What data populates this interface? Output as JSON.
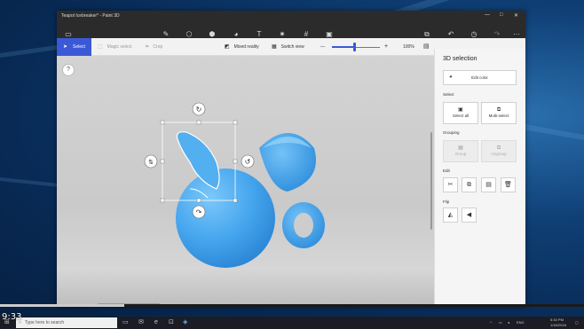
{
  "window": {
    "title": "Teapot Icebreaker* - Paint 3D",
    "min_icon": "—",
    "max_icon": "□",
    "close_icon": "✕"
  },
  "menubar": {
    "icons": {
      "menu": "▭",
      "brushes": "✎",
      "shapes2d": "⬡",
      "shapes3d": "⬢",
      "stickers": "◕",
      "text": "T",
      "effects": "✷",
      "canvas": "#",
      "library": "▣",
      "paste": "⧉",
      "undo": "↶",
      "history": "◷",
      "redo": "↷",
      "more": "···"
    }
  },
  "toolbar": {
    "select_label": "Select",
    "magic_select_label": "Magic select",
    "crop_label": "Crop",
    "mixed_reality_label": "Mixed reality",
    "switch_view_label": "Switch view",
    "zoom_minus": "—",
    "zoom_plus": "+",
    "zoom_value": "100%",
    "zoom_fraction": 0.48
  },
  "canvas": {
    "help_label": "?"
  },
  "panel": {
    "title": "3D selection",
    "edit_color_label": "Edit color",
    "select_section": "Select",
    "select_all_label": "Select all",
    "multiselect_label": "Multi-select",
    "grouping_section": "Grouping",
    "group_label": "Group",
    "ungroup_label": "Ungroup",
    "edit_section": "Edit",
    "flip_section": "Flip"
  },
  "colors": {
    "accent": "#3b59d6",
    "object": "#4aa8ee",
    "selection": "#ffffff"
  },
  "taskbar": {
    "search_placeholder": "Type here to search",
    "time": "5:34 PM",
    "date": "1/16/2018",
    "lang": "ENG"
  },
  "video": {
    "timestamp": "9:33"
  }
}
